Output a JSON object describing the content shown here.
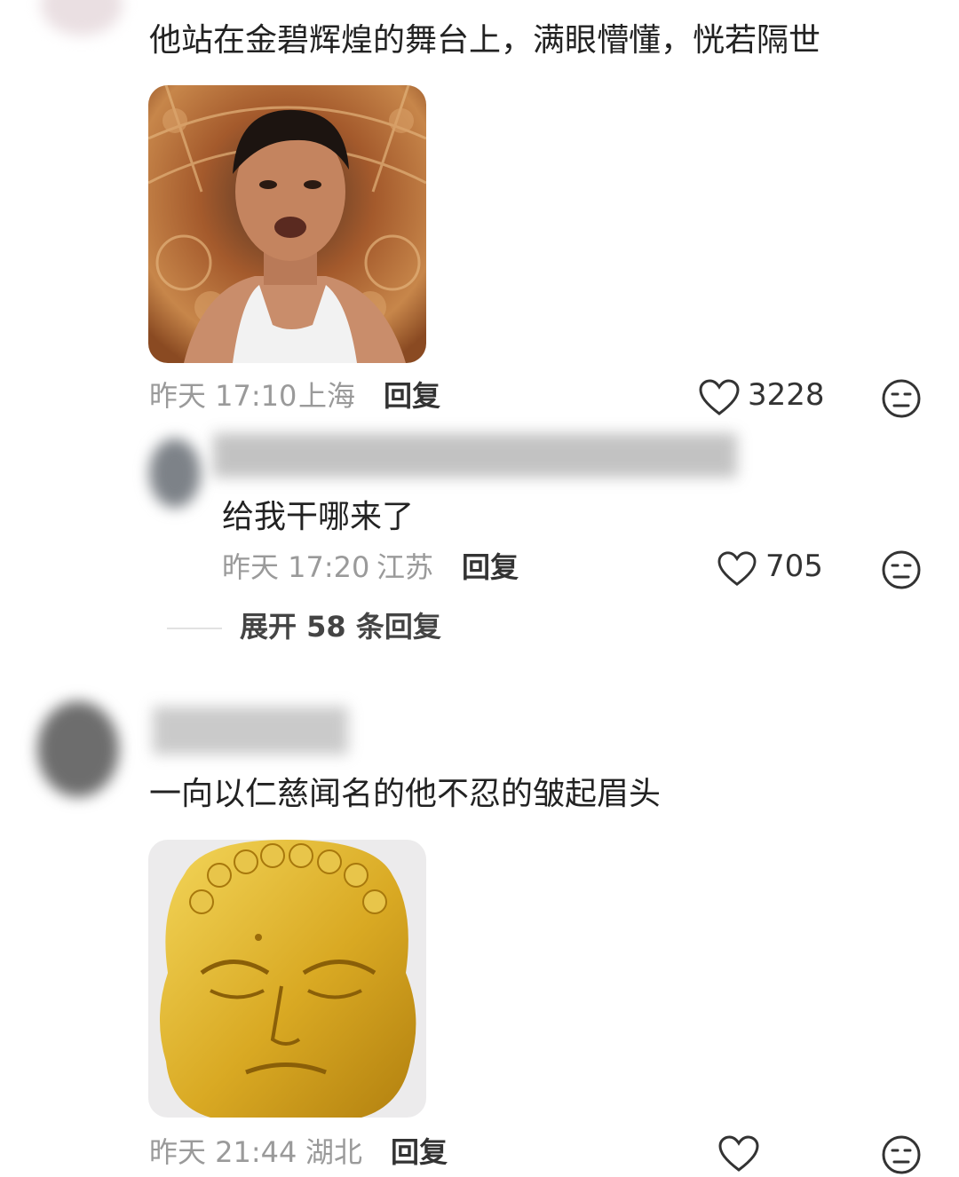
{
  "comments": [
    {
      "text": "他站在金碧辉煌的舞台上，满眼懵懂，恍若隔世",
      "time": "昨天 17:10",
      "location": "上海",
      "reply_label": "回复",
      "likes": "3228",
      "image_icon": "man-in-tank-top-meme-image"
    },
    {
      "text": "一向以仁慈闻名的他不忍的皱起眉头",
      "time": "昨天 21:44",
      "location": "湖北",
      "reply_label": "回复",
      "image_icon": "golden-buddha-head-image"
    }
  ],
  "reply": {
    "text": "给我干哪来了",
    "time": "昨天 17:20",
    "location": "江苏",
    "reply_label": "回复",
    "likes": "705"
  },
  "expand_replies": "展开 58 条回复",
  "icons": {
    "like": "heart-outline-icon",
    "dislike": "unamused-face-icon"
  },
  "colors": {
    "text": "#222222",
    "meta": "#9a9a9a",
    "background": "#ffffff"
  }
}
